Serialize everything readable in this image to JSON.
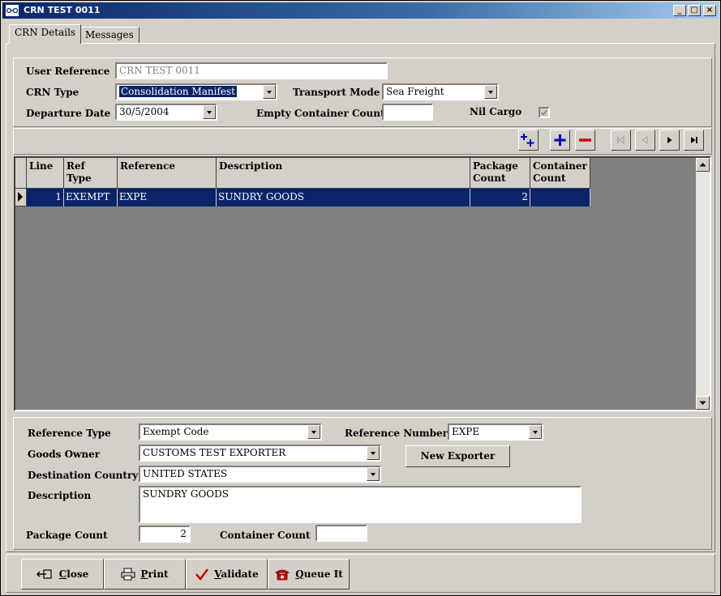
{
  "window": {
    "title": "CRN TEST 0011",
    "minimize": "_",
    "maximize": "□",
    "close": "×"
  },
  "tabs": [
    {
      "label": "CRN Details"
    },
    {
      "label": "Messages"
    }
  ],
  "header_form": {
    "user_reference_label": "User Reference",
    "user_reference_value": "CRN TEST 0011",
    "crn_type_label": "CRN Type",
    "crn_type_value": "Consolidation Manifest",
    "transport_mode_label": "Transport Mode",
    "transport_mode_value": "Sea Freight",
    "departure_date_label": "Departure Date",
    "departure_date_value": "30/5/2004",
    "empty_container_label": "Empty Container Count",
    "empty_container_value": "",
    "nil_cargo_label": "Nil Cargo",
    "nil_cargo_checked": true
  },
  "grid": {
    "columns": [
      {
        "h1": "Line",
        "h2": ""
      },
      {
        "h1": "Ref",
        "h2": "Type"
      },
      {
        "h1": "Reference",
        "h2": ""
      },
      {
        "h1": "Description",
        "h2": ""
      },
      {
        "h1": "Package",
        "h2": "Count"
      },
      {
        "h1": "Container",
        "h2": "Count"
      }
    ],
    "rows": [
      {
        "line": "1",
        "ref_type": "EXEMPT",
        "reference": "EXPE",
        "description": "SUNDRY GOODS",
        "package_count": "2",
        "container_count": ""
      }
    ]
  },
  "detail_form": {
    "reference_type_label": "Reference Type",
    "reference_type_value": "Exempt Code",
    "reference_number_label": "Reference Number",
    "reference_number_value": "EXPE",
    "goods_owner_label": "Goods Owner",
    "goods_owner_value": "CUSTOMS TEST EXPORTER",
    "new_exporter_label": "New Exporter",
    "destination_country_label": "Destination Country",
    "destination_country_value": "UNITED STATES",
    "description_label": "Description",
    "description_value": "SUNDRY GOODS",
    "package_count_label": "Package Count",
    "package_count_value": "2",
    "container_count_label": "Container Count",
    "container_count_value": ""
  },
  "buttons": {
    "close": {
      "first": "C",
      "rest": "lose"
    },
    "print": {
      "first": "P",
      "rest": "rint"
    },
    "validate": {
      "first": "V",
      "rest": "alidate"
    },
    "queue": {
      "first": "Q",
      "rest": "ueue It"
    }
  },
  "colors": {
    "selection": "#0a246a",
    "face": "#d4d0c8",
    "add_icon": "#0000cc",
    "remove_icon": "#cc0000"
  }
}
